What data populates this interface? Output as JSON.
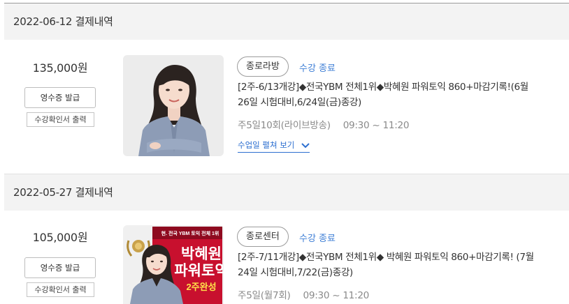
{
  "orders": [
    {
      "header": "2022-06-12 결제내역",
      "price": "135,000원",
      "receipt_button": "영수증 발급",
      "certificate_button": "수강확인서 출력",
      "badge": "종로라방",
      "status": "수강 종료",
      "title_line1": "[2주-6/13개강]◆전국YBM 전체1위◆박혜원 파워토익 860+마감기록!(6월",
      "title_line2": "26일 시험대비,6/24일(금)종강)",
      "schedule_days": "주5일10회(라이브방송)",
      "schedule_time": "09:30 ~ 11:20",
      "expand_label": "수업일 펼쳐 보기"
    },
    {
      "header": "2022-05-27 결제내역",
      "price": "105,000원",
      "receipt_button": "영수증 발급",
      "certificate_button": "수강확인서 출력",
      "badge": "종로센터",
      "status": "수강 종료",
      "title_line1": "[2주-7/11개강]◆전국YBM 전체1위◆ 박혜원 파워토익 860+마감기록! (7월",
      "title_line2": "24일 시험대비,7/22(금)종강)",
      "schedule_days": "주5일(월7회)",
      "schedule_time": "09:30 ~ 11:20",
      "poster": {
        "tagline": "현. 전국 YBM 토익 전체 1위",
        "name": "박혜원",
        "course": "파워토익",
        "ribbon": "2주완성"
      }
    }
  ],
  "colors": {
    "accent_blue": "#3f7fd6",
    "header_bg": "#f3f3f3",
    "poster_red": "#c8102e"
  }
}
